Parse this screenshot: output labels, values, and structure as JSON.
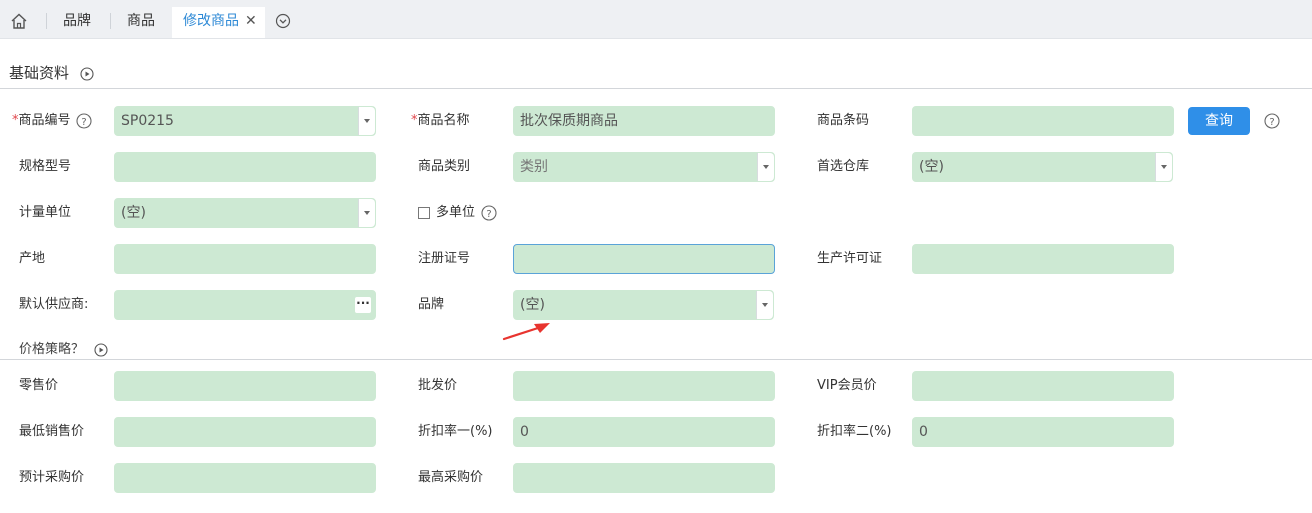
{
  "tabs": {
    "home_icon": "home-icon",
    "items": [
      {
        "label": "品牌"
      },
      {
        "label": "商品"
      },
      {
        "label": "修改商品"
      }
    ],
    "close_icon": "close-icon",
    "more_icon": "chevron-down-circle-icon"
  },
  "sections": {
    "basic": "基础资料",
    "price": "价格策略？"
  },
  "basic": {
    "code_label": "商品编号",
    "code_value": "SP0215",
    "name_label": "商品名称",
    "name_value": "批次保质期商品",
    "barcode_label": "商品条码",
    "barcode_value": "",
    "query_button": "查询",
    "spec_label": "规格型号",
    "spec_value": "",
    "category_label": "商品类别",
    "category_value": "类别",
    "warehouse_label": "首选仓库",
    "warehouse_value": "(空)",
    "unit_label": "计量单位",
    "unit_value": "(空)",
    "multi_unit_label": "多单位",
    "multi_unit_checked": false,
    "origin_label": "产地",
    "origin_value": "",
    "reg_label": "注册证号",
    "reg_value": "",
    "license_label": "生产许可证",
    "license_value": "",
    "supplier_label": "默认供应商:",
    "supplier_value": "",
    "brand_label": "品牌",
    "brand_value": "(空)"
  },
  "price": {
    "retail_label": "零售价",
    "retail_value": "",
    "wholesale_label": "批发价",
    "wholesale_value": "",
    "vip_label": "VIP会员价",
    "vip_value": "",
    "min_sale_label": "最低销售价",
    "min_sale_value": "",
    "discount1_label": "折扣率一(%)",
    "discount1_value": "0",
    "discount2_label": "折扣率二(%)",
    "discount2_value": "0",
    "est_purchase_label": "预计采购价",
    "est_purchase_value": "",
    "max_purchase_label": "最高采购价",
    "max_purchase_value": ""
  },
  "colors": {
    "field_bg": "#cde9d3",
    "accent": "#2f8fe8",
    "required": "#e0454a",
    "annotation_arrow": "#e8342f"
  }
}
